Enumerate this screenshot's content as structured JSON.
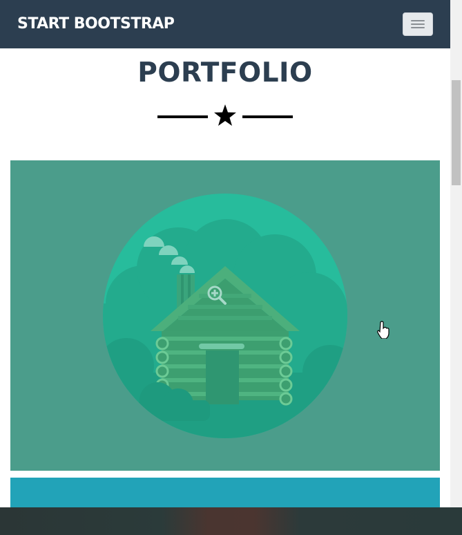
{
  "navbar": {
    "brand": "START BOOTSTRAP",
    "toggle_icon": "hamburger-icon",
    "background": "#2c3e50"
  },
  "section": {
    "title": "PORTFOLIO",
    "divider_icon": "star-icon"
  },
  "portfolio": {
    "items": [
      {
        "image": "cabin-illustration",
        "overlay_icon": "zoom-in-icon",
        "background": "#4b9d8b"
      },
      {
        "image": "illustration",
        "background": "#22a3b8"
      }
    ]
  },
  "colors": {
    "title": "#2c3e50",
    "accent_green": "#26bc9c"
  }
}
